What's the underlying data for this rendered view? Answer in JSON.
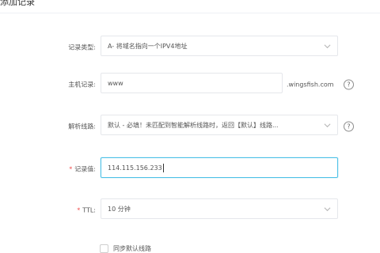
{
  "header": {
    "title": "添加记录"
  },
  "form": {
    "record_type": {
      "label": "记录类型:",
      "value": "A- 将域名指向一个IPV4地址"
    },
    "host": {
      "label": "主机记录:",
      "value": "www",
      "suffix": ".wingsfish.com",
      "help": "?"
    },
    "line": {
      "label": "解析线路:",
      "value": "默认 - 必填！未匹配到智能解析线路时，返回【默认】线路...",
      "help": "?"
    },
    "record_value": {
      "required_mark": "*",
      "label": "记录值:",
      "value": "114.115.156.233"
    },
    "ttl": {
      "required_mark": "*",
      "label": "TTL:",
      "value": "10 分钟"
    },
    "sync_default_line": {
      "label": "同步默认线路",
      "checked": false
    }
  },
  "icons": {
    "dropdown": "chevron-down-icon",
    "help": "question-circle-icon"
  }
}
